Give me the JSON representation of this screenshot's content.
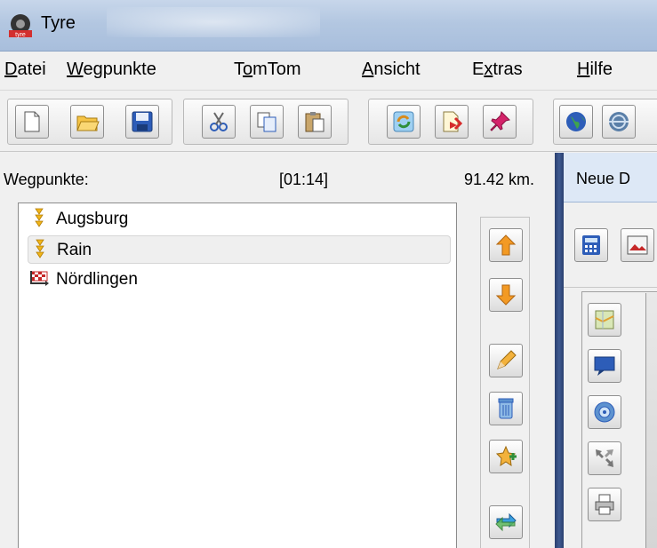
{
  "window": {
    "title": "Tyre",
    "icon": "tyre-app-icon"
  },
  "menu": {
    "items": [
      {
        "prefix": "",
        "mnemonic": "D",
        "rest": "atei"
      },
      {
        "prefix": "",
        "mnemonic": "W",
        "rest": "egpunkte"
      },
      {
        "prefix": "T",
        "mnemonic": "o",
        "rest": "mTom"
      },
      {
        "prefix": "",
        "mnemonic": "A",
        "rest": "nsicht"
      },
      {
        "prefix": "E",
        "mnemonic": "x",
        "rest": "tras"
      },
      {
        "prefix": "",
        "mnemonic": "H",
        "rest": "ilfe"
      }
    ]
  },
  "toolbar": {
    "buttons": [
      "new-document-icon",
      "open-folder-icon",
      "save-icon",
      "cut-icon",
      "copy-icon",
      "paste-icon",
      "refresh-icon",
      "import-icon",
      "pin-icon",
      "globe-icon",
      "earth-icon"
    ]
  },
  "waypoints": {
    "header_label": "Wegpunkte:",
    "duration": "[01:14]",
    "distance": "91.42 km.",
    "items": [
      {
        "label": "Augsburg",
        "icon": "waypoint-arrow-icon"
      },
      {
        "label": "Rain",
        "icon": "waypoint-arrow-icon"
      },
      {
        "label": "Nördlingen",
        "icon": "finish-flag-icon"
      }
    ],
    "selected_index": 1
  },
  "side_buttons": [
    "move-up-icon",
    "move-down-icon",
    "edit-icon",
    "delete-icon",
    "add-star-icon",
    "reverse-icon"
  ],
  "right_panel": {
    "tab_label": "Neue D",
    "tools": [
      "calculator-icon",
      "image-icon",
      "map-icon",
      "speech-bubble-icon",
      "target-icon",
      "zoom-icon",
      "printer-icon"
    ]
  },
  "colors": {
    "titlebar": "#b3c7e1",
    "splitter": "#2a3f6e",
    "arrow_orange": "#f39a24",
    "flag_red": "#c62828"
  }
}
